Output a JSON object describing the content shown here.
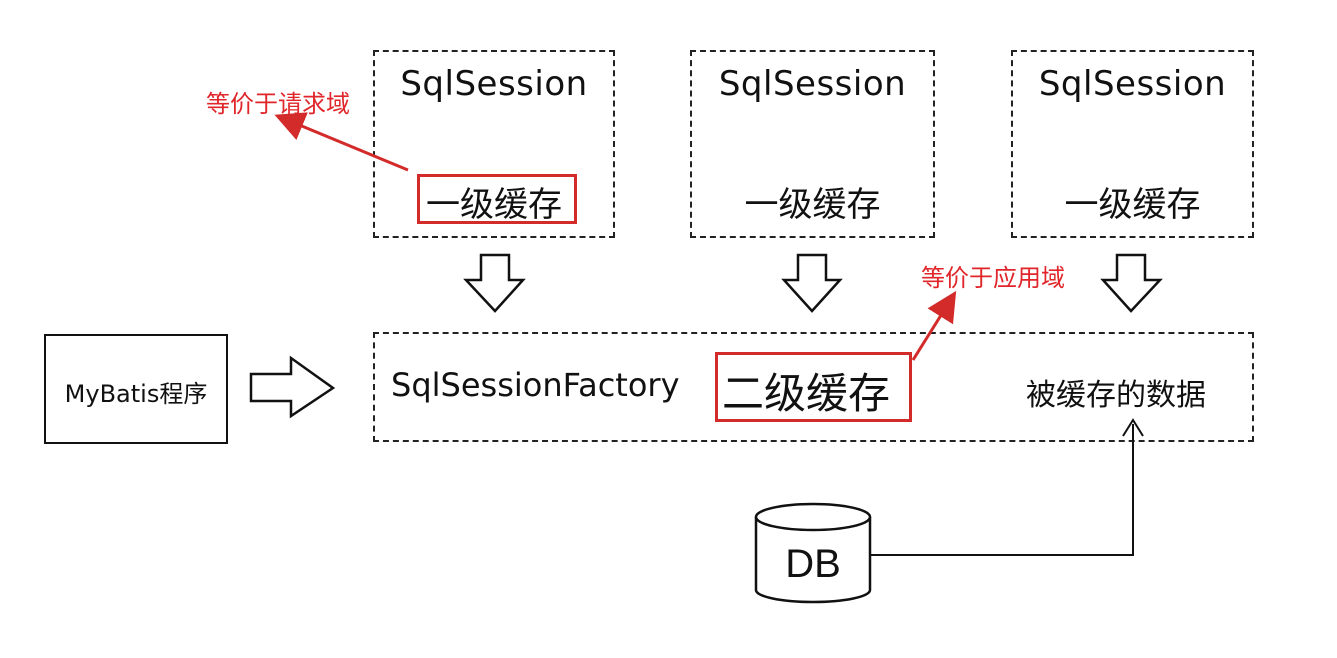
{
  "sessions": [
    {
      "title": "SqlSession",
      "cache_label": "一级缓存"
    },
    {
      "title": "SqlSession",
      "cache_label": "一级缓存"
    },
    {
      "title": "SqlSession",
      "cache_label": "一级缓存"
    }
  ],
  "factory": {
    "label": "SqlSessionFactory",
    "cache_label": "二级缓存",
    "cached_data_label": "被缓存的数据"
  },
  "program": {
    "label": "MyBatis程序"
  },
  "db": {
    "label": "DB"
  },
  "annotations": {
    "request_scope": "等价于请求域",
    "application_scope": "等价于应用域"
  },
  "colors": {
    "annotation": "#e0262a",
    "line": "#222222"
  },
  "icons": {
    "down_arrow": "hollow-down-arrow",
    "right_arrow": "hollow-right-arrow",
    "database": "database-cylinder"
  }
}
